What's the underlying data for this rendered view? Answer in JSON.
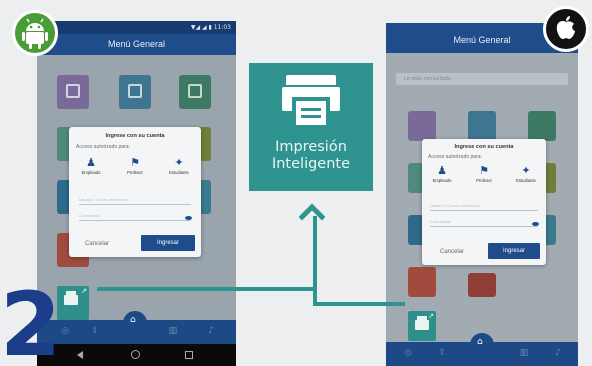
{
  "step_number": "2",
  "android_phone": {
    "status_time": "▼◢ ◢ ▮ 11:03",
    "title": "Menú General",
    "dialog": {
      "title": "Ingrese con su cuenta",
      "subtitle": "Acceso autorizado para:",
      "roles": [
        "Empleado",
        "Profesor",
        "Estudiante"
      ],
      "user_placeholder": "Usuario / Correo electrónico",
      "password_placeholder": "Contraseña",
      "cancel_label": "Cancelar",
      "login_label": "Ingresar"
    }
  },
  "ios_phone": {
    "title": "Menú General",
    "search_placeholder": "Lo más consultado",
    "dialog": {
      "title": "Ingrese con su cuenta",
      "subtitle": "Acceso autorizado para:",
      "roles": [
        "Empleado",
        "Profesor",
        "Estudiante"
      ],
      "user_placeholder": "Usuario / Correo electrónico",
      "password_placeholder": "Contraseña",
      "cancel_label": "Cancelar",
      "login_label": "Ingresar"
    }
  },
  "feature": {
    "line1": "Impresión",
    "line2": "Inteligente"
  },
  "icons": {
    "android": "android-logo-icon",
    "apple": "apple-logo-icon",
    "printer": "printer-icon"
  },
  "colors": {
    "teal": "#2f9490",
    "navy": "#1f4d8c",
    "android_green": "#4a9d36",
    "step_blue": "#1c3d8a"
  }
}
